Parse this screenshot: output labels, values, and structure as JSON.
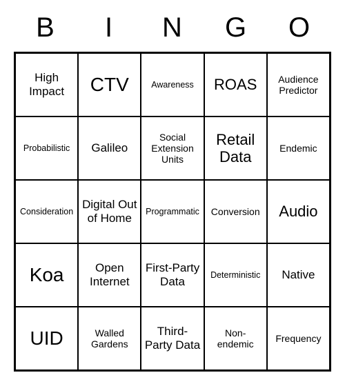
{
  "header": [
    "B",
    "I",
    "N",
    "G",
    "O"
  ],
  "grid": [
    [
      {
        "text": "High Impact",
        "size": "m"
      },
      {
        "text": "CTV",
        "size": "xl"
      },
      {
        "text": "Awareness",
        "size": "xs"
      },
      {
        "text": "ROAS",
        "size": "l"
      },
      {
        "text": "Audience Predictor",
        "size": "s"
      }
    ],
    [
      {
        "text": "Probabilistic",
        "size": "xs"
      },
      {
        "text": "Galileo",
        "size": "m"
      },
      {
        "text": "Social Extension Units",
        "size": "s"
      },
      {
        "text": "Retail Data",
        "size": "l"
      },
      {
        "text": "Endemic",
        "size": "s"
      }
    ],
    [
      {
        "text": "Consideration",
        "size": "xs"
      },
      {
        "text": "Digital Out of Home",
        "size": "m"
      },
      {
        "text": "Programmatic",
        "size": "xs"
      },
      {
        "text": "Conversion",
        "size": "s"
      },
      {
        "text": "Audio",
        "size": "l"
      }
    ],
    [
      {
        "text": "Koa",
        "size": "xl"
      },
      {
        "text": "Open Internet",
        "size": "m"
      },
      {
        "text": "First-Party Data",
        "size": "m"
      },
      {
        "text": "Deterministic",
        "size": "xs"
      },
      {
        "text": "Native",
        "size": "m"
      }
    ],
    [
      {
        "text": "UID",
        "size": "xl"
      },
      {
        "text": "Walled Gardens",
        "size": "s"
      },
      {
        "text": "Third-Party Data",
        "size": "m"
      },
      {
        "text": "Non-endemic",
        "size": "s"
      },
      {
        "text": "Frequency",
        "size": "s"
      }
    ]
  ]
}
